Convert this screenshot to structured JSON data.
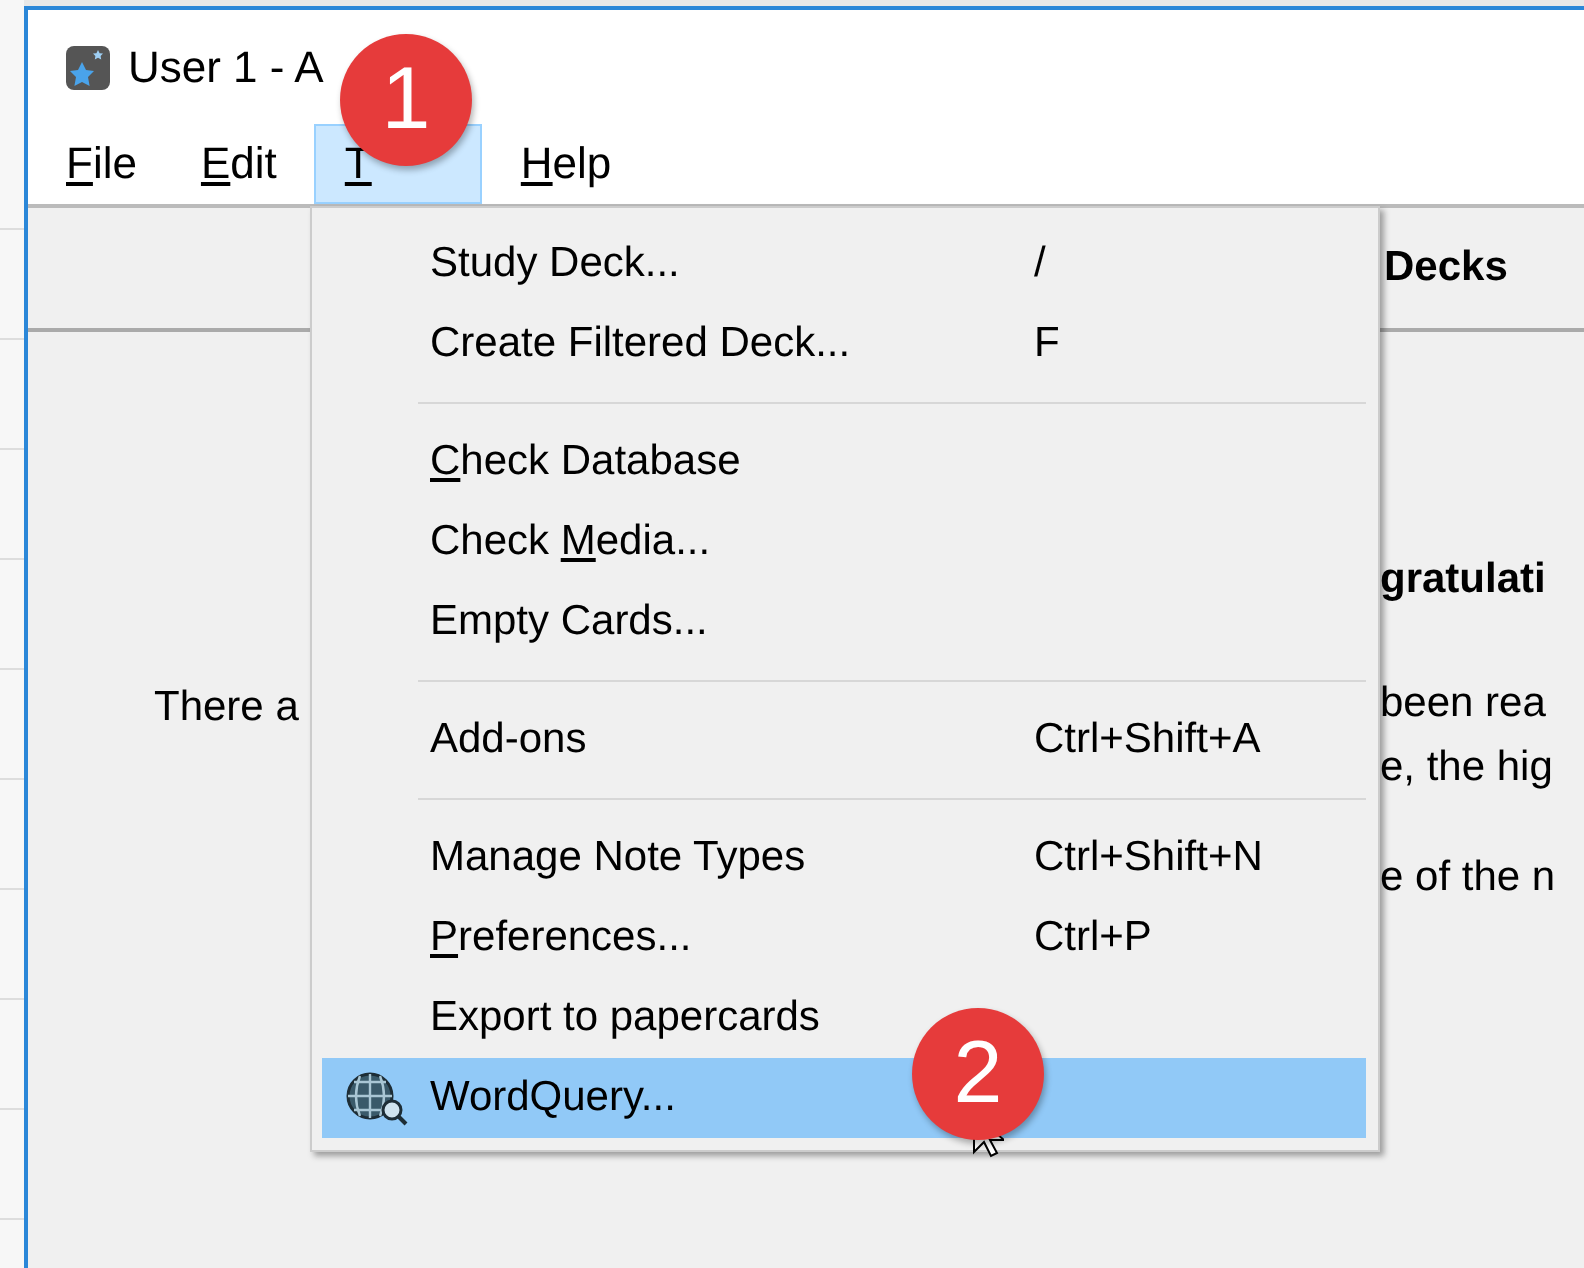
{
  "window": {
    "title": "User 1 - A"
  },
  "menu_bar": [
    {
      "key": "F",
      "after": "ile",
      "selected": false
    },
    {
      "key": "E",
      "after": "dit",
      "selected": false
    },
    {
      "key": "T",
      "selected": true
    },
    {
      "key": "H",
      "after": "elp",
      "selected": false
    }
  ],
  "tools_menu": [
    {
      "kind": "item",
      "label": "Study Deck...",
      "shortcut": "/",
      "selected": false
    },
    {
      "kind": "item",
      "label": "Create Filtered Deck...",
      "shortcut": "F",
      "selected": false
    },
    {
      "kind": "separator"
    },
    {
      "kind": "item",
      "label": {
        "key": "C",
        "after": "heck Database"
      },
      "selected": false
    },
    {
      "kind": "item",
      "label": {
        "before": "Check ",
        "key": "M",
        "after": "edia..."
      },
      "selected": false
    },
    {
      "kind": "item",
      "label": "Empty Cards...",
      "selected": false
    },
    {
      "kind": "separator"
    },
    {
      "kind": "item",
      "label": "Add-ons",
      "shortcut": "Ctrl+Shift+A",
      "selected": false
    },
    {
      "kind": "separator"
    },
    {
      "kind": "item",
      "label": "Manage Note Types",
      "shortcut": "Ctrl+Shift+N",
      "selected": false
    },
    {
      "kind": "item",
      "label": {
        "key": "P",
        "after": "references..."
      },
      "shortcut": "Ctrl+P",
      "selected": false
    },
    {
      "kind": "item",
      "label": "Export to papercards",
      "selected": false
    },
    {
      "kind": "icon-item",
      "label": "WordQuery...",
      "selected": true
    }
  ],
  "content": {
    "header": "Decks",
    "left_text": "There a",
    "right_texts": [
      {
        "kind": "heading",
        "text": "gratulati"
      },
      {
        "kind": "line",
        "text": "been rea"
      },
      {
        "kind": "line",
        "text": "e, the hig"
      },
      {
        "kind": "gap-line",
        "text": "e of the n"
      }
    ]
  },
  "step_markers": [
    "1",
    "2"
  ]
}
